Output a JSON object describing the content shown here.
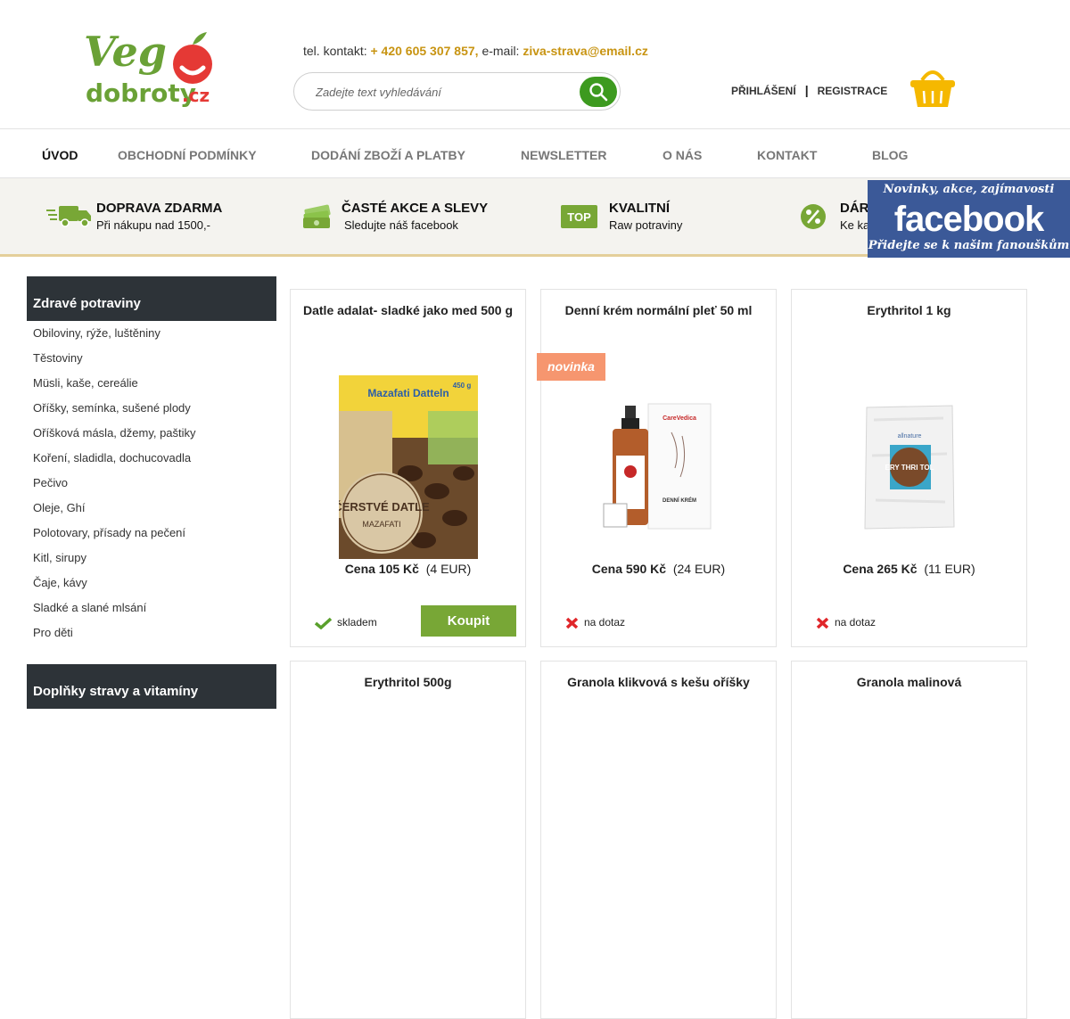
{
  "logo": {
    "text_top": "Veg",
    "text_bottom": "dobroty",
    "tld": ".cz"
  },
  "contact": {
    "phone_label": "tel. kontakt:",
    "phone": "+ 420 605 307 857,",
    "email_label": "e-mail:",
    "email": "ziva-strava@email.cz"
  },
  "search": {
    "placeholder": "Zadejte text vyhledávání",
    "button_icon": "search-icon"
  },
  "auth": {
    "login": "PŘIHLÁŠENÍ",
    "separator": "|",
    "register": "REGISTRACE"
  },
  "cart": {
    "icon": "basket-icon"
  },
  "nav": [
    {
      "label": "ÚVOD",
      "active": true
    },
    {
      "label": "OBCHODNÍ PODMÍNKY"
    },
    {
      "label": "DODÁNÍ ZBOŽÍ A PLATBY"
    },
    {
      "label": "NEWSLETTER"
    },
    {
      "label": "O NÁS"
    },
    {
      "label": "KONTAKT"
    },
    {
      "label": "BLOG"
    }
  ],
  "benefits": [
    {
      "icon": "delivery-truck-icon",
      "title": "DOPRAVA ZDARMA",
      "subtitle": "Při nákupu nad 1500,-"
    },
    {
      "icon": "money-stack-icon",
      "title": "ČASTÉ AKCE A SLEVY",
      "subtitle": "Sledujte náš facebook"
    },
    {
      "icon": "top-badge-icon",
      "title": "KVALITNÍ",
      "subtitle": "Raw potraviny",
      "badge_text": "TOP"
    },
    {
      "icon": "percent-icon",
      "title": "DÁR",
      "subtitle": "Ke ka"
    }
  ],
  "facebook_banner": {
    "line1": "Novinky, akce, zajímavosti",
    "line2": "facebook",
    "line3": "Přidejte se k našim fanouškům"
  },
  "sidebar": {
    "section1_title": "Zdravé potraviny",
    "items": [
      "Obiloviny, rýže, luštěniny",
      "Těstoviny",
      "Müsli, kaše, cereálie",
      "Oříšky, semínka, sušené plody",
      "Oříšková másla, džemy, paštiky",
      "Koření, sladidla, dochucovadla",
      "Pečivo",
      "Oleje, Ghí",
      "Polotovary, přísady na pečení",
      "Kitl, sirupy",
      "Čaje, kávy",
      "Sladké a slané mlsání",
      "Pro děti"
    ],
    "section2_title": "Doplňky stravy a vitamíny"
  },
  "products": [
    {
      "name": "Datle adalat- sladké jako med 500 g",
      "price_label": "Cena 105 Kč",
      "price_eur": "(4 EUR)",
      "stock": "skladem",
      "in_stock": true,
      "buy_label": "Koupit",
      "img_text_top": "Mazafati Datteln",
      "img_text_big": "ČERSTVÉ DATLE",
      "img_text_small": "MAZAFATI",
      "img_weight": "450 g"
    },
    {
      "name": "Denní krém normální pleť 50 ml",
      "price_label": "Cena 590 Kč",
      "price_eur": "(24 EUR)",
      "stock": "na dotaz",
      "in_stock": false,
      "badge": "novinka",
      "img_text_brand": "CareVedica",
      "img_text_box": "DENNÍ KRÉM"
    },
    {
      "name": "Erythritol 1 kg",
      "price_label": "Cena 265 Kč",
      "price_eur": "(11 EUR)",
      "stock": "na dotaz",
      "in_stock": false,
      "img_text_brand": "allnature",
      "img_text_label": "ERY THRI TOL"
    },
    {
      "name": "Erythritol 500g"
    },
    {
      "name": "Granola klikvová s kešu oříšky"
    },
    {
      "name": "Granola malinová"
    }
  ],
  "colors": {
    "accent_green": "#78a736",
    "gold": "#c89412",
    "sidebar_dark": "#2d3338",
    "badge": "#f6966f",
    "facebook": "#3b5998"
  }
}
